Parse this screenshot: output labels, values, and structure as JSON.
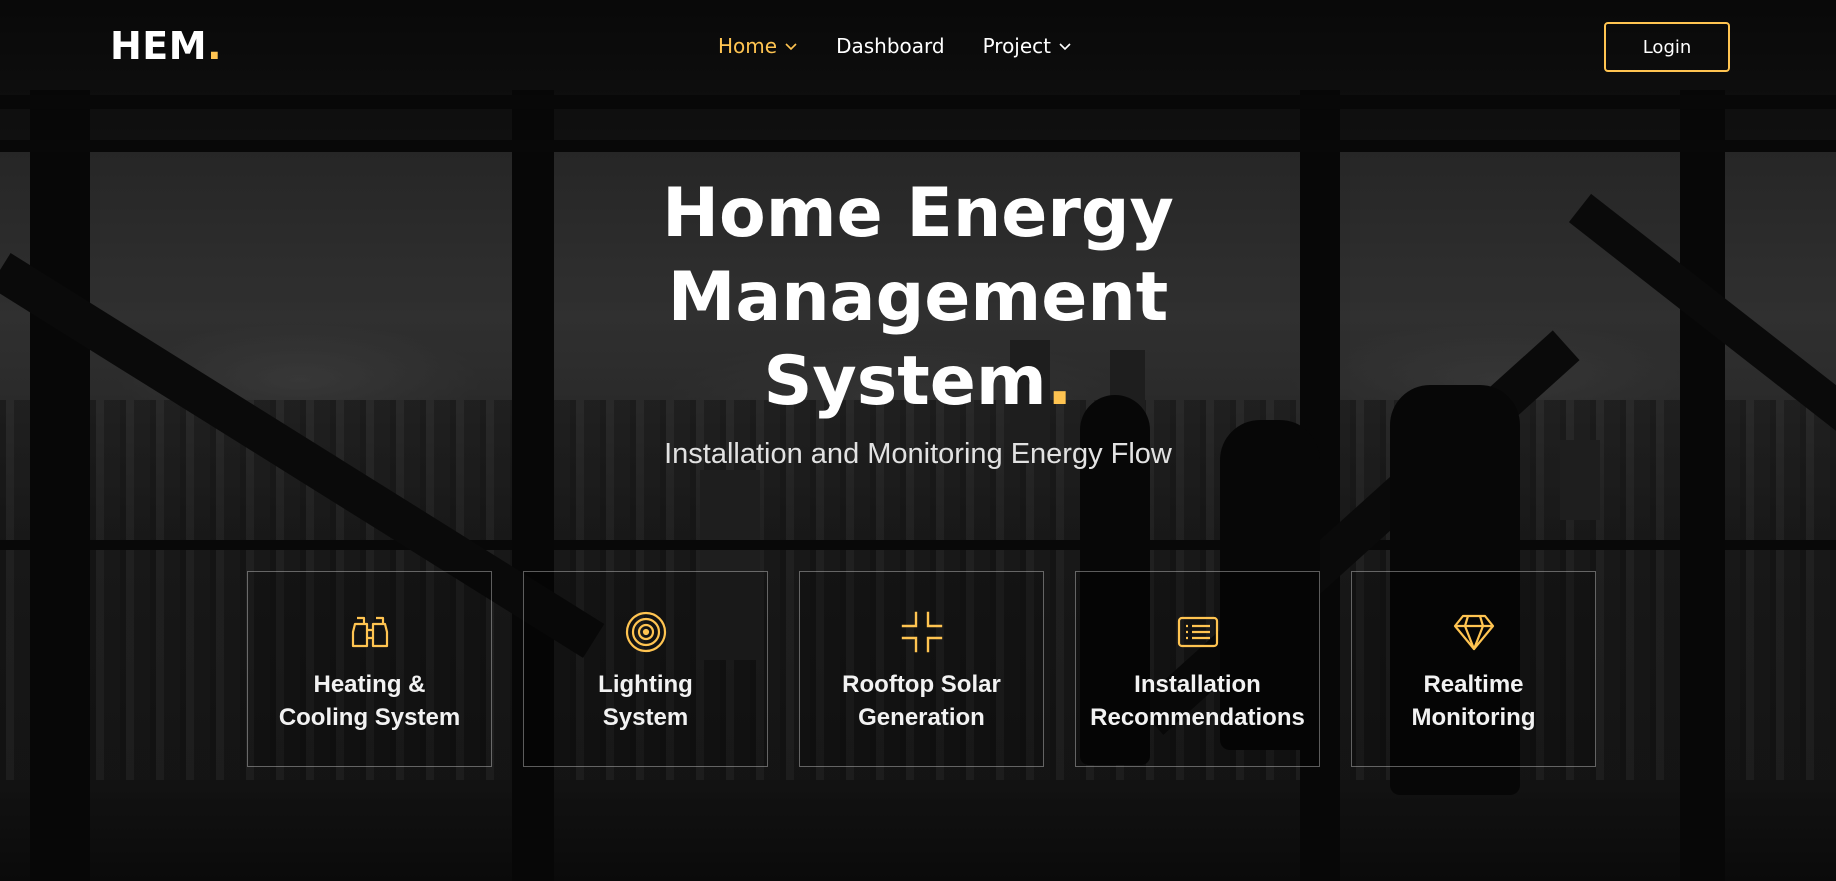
{
  "brand": {
    "name": "HEM",
    "dot": ".",
    "accent_color": "#ffc451"
  },
  "nav": {
    "items": [
      {
        "label": "Home",
        "active": true,
        "dropdown": true
      },
      {
        "label": "Dashboard",
        "active": false,
        "dropdown": false
      },
      {
        "label": "Project",
        "active": false,
        "dropdown": true
      }
    ],
    "login_label": "Login"
  },
  "hero": {
    "title_lines": [
      "Home Energy",
      "Management",
      "System"
    ],
    "title_dot": ".",
    "subtitle": "Installation and Monitoring Energy Flow"
  },
  "features": [
    {
      "label": "Heating &\nCooling System",
      "icon": "binoculars-icon"
    },
    {
      "label": "Lighting\nSystem",
      "icon": "target-icon"
    },
    {
      "label": "Rooftop Solar\nGeneration",
      "icon": "compress-icon"
    },
    {
      "label": "Installation\nRecommendations",
      "icon": "list-card-icon"
    },
    {
      "label": "Realtime\nMonitoring",
      "icon": "gem-icon"
    }
  ]
}
